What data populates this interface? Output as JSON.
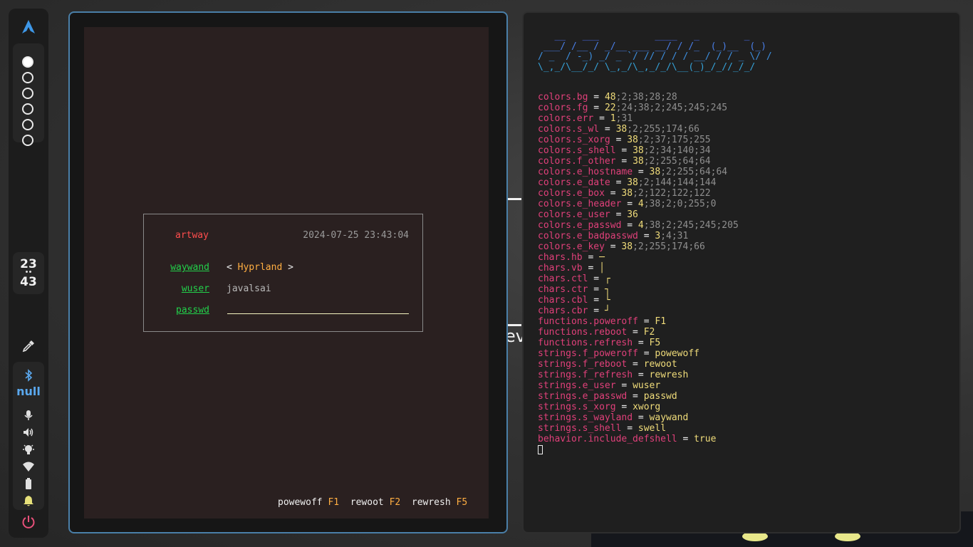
{
  "bar": {
    "workspaces": [
      {
        "active": true
      },
      {
        "active": false
      },
      {
        "active": false
      },
      {
        "active": false
      },
      {
        "active": false
      },
      {
        "active": false
      }
    ],
    "clock": {
      "hour": "23",
      "minute": "43"
    },
    "bluetooth_status": "null",
    "icons": [
      "arch-logo-icon",
      "color-picker-icon",
      "bluetooth-icon",
      "microphone-icon",
      "volume-icon",
      "brightness-icon",
      "wifi-icon",
      "battery-icon",
      "notification-bell-icon",
      "power-icon"
    ],
    "accent": "#5aa8ee"
  },
  "greeter": {
    "hostname": "artway",
    "datetime": "2024-07-25 23:43:04",
    "session_label": "waywand",
    "session_value": "Hyprland",
    "user_label": "wuser",
    "user_value": "javalsai",
    "password_label": "passwd",
    "footer": [
      {
        "label": "powewoff",
        "key": "F1"
      },
      {
        "label": "rewoot",
        "key": "F2"
      },
      {
        "label": "rewresh",
        "key": "F5"
      }
    ]
  },
  "background_fragment": "ev",
  "terminal": {
    "ascii_art": [
      "   __   ___          ____   _        _",
      " ___/ /__ / _/__ ___ __/ / /_  (_)__  (_)",
      "/ _  / -_) _/ _ `/ // / / / __/ / / _ \\/ /",
      "\\_,_/\\__/_/ \\_,_/\\_,_/_/\\__(_)_/_//_/_/"
    ],
    "config": [
      {
        "key": "colors.bg",
        "value": "48",
        "extra": ";2;38;28;28"
      },
      {
        "key": "colors.fg",
        "value": "22",
        "extra": ";24;38;2;245;245;245"
      },
      {
        "key": "colors.err",
        "value": "1",
        "extra": ";31"
      },
      {
        "key": "colors.s_wl",
        "value": "38",
        "extra": ";2;255;174;66"
      },
      {
        "key": "colors.s_xorg",
        "value": "38",
        "extra": ";2;37;175;255"
      },
      {
        "key": "colors.s_shell",
        "value": "38",
        "extra": ";2;34;140;34"
      },
      {
        "key": "colors.f_other",
        "value": "38",
        "extra": ";2;255;64;64"
      },
      {
        "key": "colors.e_hostname",
        "value": "38",
        "extra": ";2;255;64;64"
      },
      {
        "key": "colors.e_date",
        "value": "38",
        "extra": ";2;144;144;144"
      },
      {
        "key": "colors.e_box",
        "value": "38",
        "extra": ";2;122;122;122"
      },
      {
        "key": "colors.e_header",
        "value": "4",
        "extra": ";38;2;0;255;0"
      },
      {
        "key": "colors.e_user",
        "value": "36",
        "extra": ""
      },
      {
        "key": "colors.e_passwd",
        "value": "4",
        "extra": ";38;2;245;245;205"
      },
      {
        "key": "colors.e_badpasswd",
        "value": "3",
        "extra": ";4;31"
      },
      {
        "key": "colors.e_key",
        "value": "38",
        "extra": ";2;255;174;66"
      },
      {
        "key": "chars.hb",
        "value": "─",
        "extra": ""
      },
      {
        "key": "chars.vb",
        "value": "│",
        "extra": ""
      },
      {
        "key": "chars.ctl",
        "value": "┌",
        "extra": ""
      },
      {
        "key": "chars.ctr",
        "value": "┐",
        "extra": ""
      },
      {
        "key": "chars.cbl",
        "value": "└",
        "extra": ""
      },
      {
        "key": "chars.cbr",
        "value": "┘",
        "extra": ""
      },
      {
        "key": "functions.poweroff",
        "value": "F1",
        "extra": ""
      },
      {
        "key": "functions.reboot",
        "value": "F2",
        "extra": ""
      },
      {
        "key": "functions.refresh",
        "value": "F5",
        "extra": ""
      },
      {
        "key": "strings.f_poweroff",
        "value": "powewoff",
        "extra": ""
      },
      {
        "key": "strings.f_reboot",
        "value": "rewoot",
        "extra": ""
      },
      {
        "key": "strings.f_refresh",
        "value": "rewresh",
        "extra": ""
      },
      {
        "key": "strings.e_user",
        "value": "wuser",
        "extra": ""
      },
      {
        "key": "strings.e_passwd",
        "value": "passwd",
        "extra": ""
      },
      {
        "key": "strings.s_xorg",
        "value": "xworg",
        "extra": ""
      },
      {
        "key": "strings.s_wayland",
        "value": "waywand",
        "extra": ""
      },
      {
        "key": "strings.s_shell",
        "value": "swell",
        "extra": ""
      },
      {
        "key": "behavior.include_defshell",
        "value": "true",
        "extra": ""
      }
    ]
  }
}
